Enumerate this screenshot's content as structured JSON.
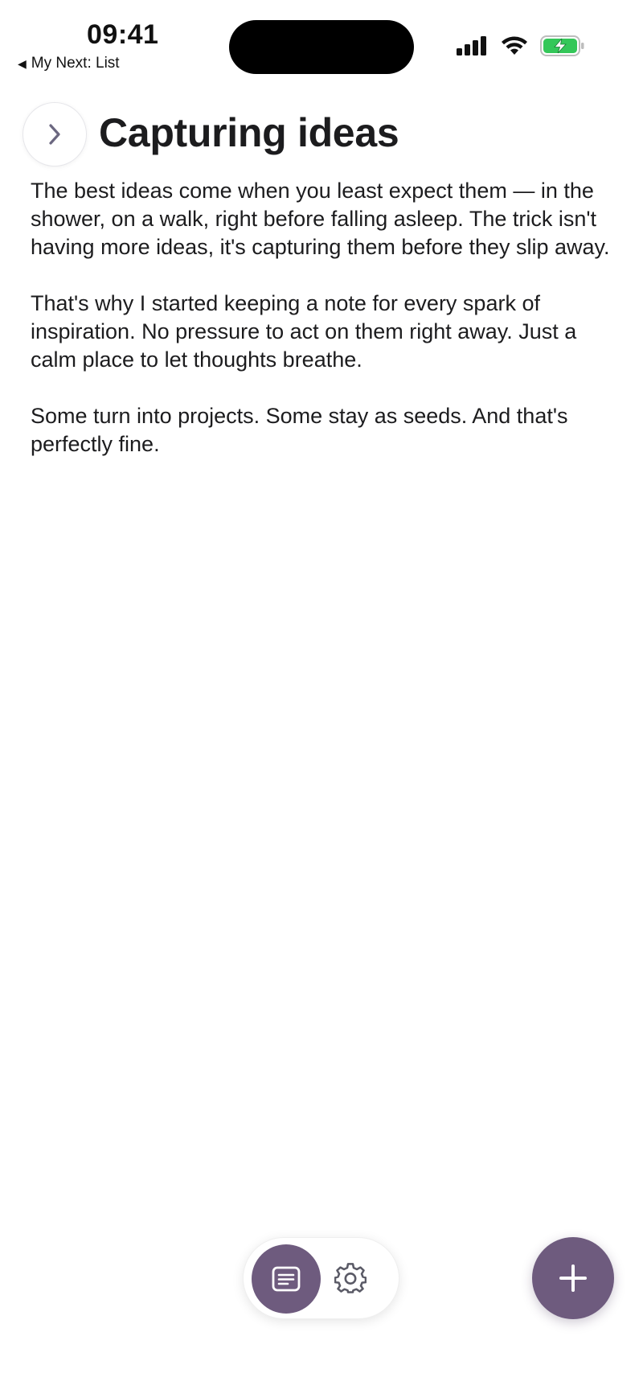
{
  "status_bar": {
    "time": "09:41",
    "back_label": "My Next: List",
    "icons": [
      "cellular-signal-icon",
      "wifi-icon",
      "battery-charging-icon"
    ],
    "battery_color": "#34c759"
  },
  "header": {
    "toggle_icon": "chevron-right-icon",
    "title": "Capturing ideas"
  },
  "note": {
    "paragraphs": [
      "The best ideas come when you least expect them — in the shower, on a walk, right before falling asleep. The trick isn't having more ideas, it's capturing them before they slip away.",
      "That's why I started keeping a note for every spark of inspiration. No pressure to act on them right away. Just a calm place to let thoughts breathe.",
      "Some turn into projects. Some stay as seeds. And that's perfectly fine."
    ]
  },
  "bottom_bar": {
    "notes_icon": "notes-icon",
    "settings_icon": "gear-icon",
    "add_icon": "plus-icon"
  },
  "colors": {
    "accent": "#6e5b7e",
    "text": "#1c1c1e",
    "background": "#ffffff"
  }
}
